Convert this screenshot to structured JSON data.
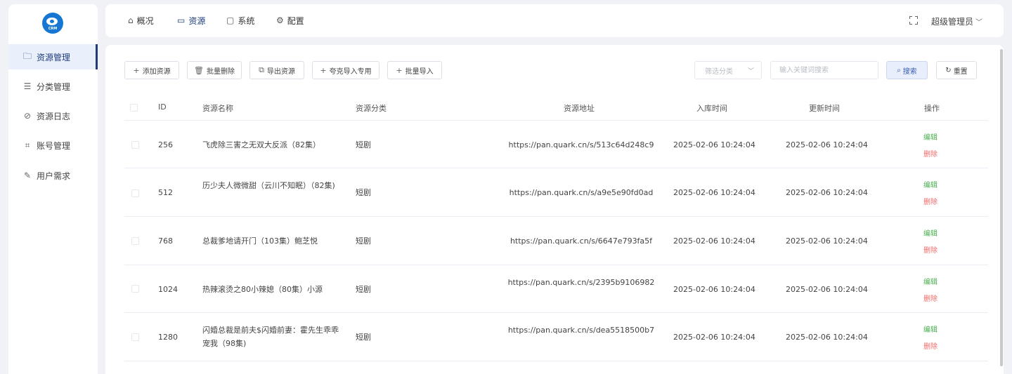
{
  "logo": {
    "text": "CRM"
  },
  "sidebar": {
    "items": [
      {
        "label": "资源管理",
        "icon": "folder-icon"
      },
      {
        "label": "分类管理",
        "icon": "sliders-icon"
      },
      {
        "label": "资源日志",
        "icon": "compass-icon"
      },
      {
        "label": "账号管理",
        "icon": "crop-icon"
      },
      {
        "label": "用户需求",
        "icon": "pen-icon"
      }
    ]
  },
  "topnav": {
    "tabs": [
      {
        "label": "概况",
        "icon": "home-icon"
      },
      {
        "label": "资源",
        "icon": "layers-icon"
      },
      {
        "label": "系统",
        "icon": "monitor-icon"
      },
      {
        "label": "配置",
        "icon": "gear-icon"
      }
    ],
    "user": "超级管理员"
  },
  "toolbar": {
    "add": "添加资源",
    "batch_delete": "批量删除",
    "export": "导出资源",
    "quark_import": "夸克导入专用",
    "batch_import": "批量导入",
    "category_placeholder": "筛选分类",
    "keyword_placeholder": "输入关键词搜索",
    "search": "搜索",
    "reset": "重置"
  },
  "table": {
    "headers": {
      "id": "ID",
      "name": "资源名称",
      "category": "资源分类",
      "url": "资源地址",
      "created": "入库时间",
      "updated": "更新时间",
      "ops": "操作"
    },
    "edit_label": "编辑",
    "delete_label": "删除",
    "rows": [
      {
        "id": "256",
        "name": "飞虎除三害之无双大反派（82集）",
        "category": "短剧",
        "url": "https://pan.quark.cn/s/513c64d248c9",
        "created": "2025-02-06 10:24:04",
        "updated": "2025-02-06 10:24:04"
      },
      {
        "id": "512",
        "name": "历少夫人微微甜（云川不知眠）（82集)",
        "category": "短剧",
        "url": "https://pan.quark.cn/s/a9e5e90fd0ad",
        "created": "2025-02-06 10:24:04",
        "updated": "2025-02-06 10:24:04"
      },
      {
        "id": "768",
        "name": "总裁爹地请开门（103集）鲍芝悦",
        "category": "短剧",
        "url": "https://pan.quark.cn/s/6647e793fa5f",
        "created": "2025-02-06 10:24:04",
        "updated": "2025-02-06 10:24:04"
      },
      {
        "id": "1024",
        "name": "热辣滚烫之80小辣媳（80集）小源",
        "category": "短剧",
        "url": "https://pan.quark.cn/s/2395b9106982",
        "created": "2025-02-06 10:24:04",
        "updated": "2025-02-06 10:24:04"
      },
      {
        "id": "1280",
        "name": "闪婚总裁是前夫$闪婚前妻：霍先生乖乖宠我（98集)",
        "category": "短剧",
        "url": "https://pan.quark.cn/s/dea5518500b7",
        "created": "2025-02-06 10:24:04",
        "updated": "2025-02-06 10:24:04"
      }
    ]
  }
}
